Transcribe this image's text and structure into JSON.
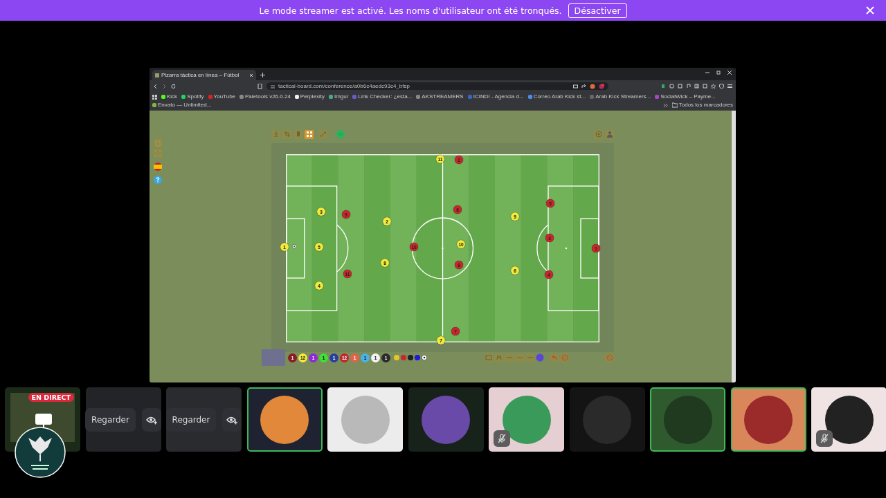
{
  "banner": {
    "message": "Le mode streamer est activé. Les noms d'utilisateur ont été tronqués.",
    "button": "Désactiver"
  },
  "browser": {
    "tab_title": "Pizarra táctica en línea – Fútbol",
    "url": "tactical-board.com/conference/a0b6c4aedc93c4_bfsp",
    "bookmarks": [
      "Kick",
      "Spotify",
      "YouTube",
      "Paletools v26.0.24",
      "Perplexity",
      "Imgur",
      "Link Checker: ¿esta...",
      "AKSTREAMERS",
      "ICINDI - Agencia d...",
      "Correo Arab Kick st...",
      "Arab Kick Streamers...",
      "SocialWick – Payme...",
      "Envato — Unlimited..."
    ],
    "all_bookmarks": "Todos los marcadores"
  },
  "board": {
    "players": [
      {
        "number": "11",
        "color": "#f2ea3c"
      },
      {
        "number": "3",
        "color": "#f2ea3c"
      },
      {
        "number": "2",
        "color": "#f2ea3c"
      },
      {
        "number": "1",
        "color": "#f2ea3c"
      },
      {
        "number": "5",
        "color": "#f2ea3c"
      },
      {
        "number": "8",
        "color": "#f2ea3c"
      },
      {
        "number": "4",
        "color": "#f2ea3c"
      },
      {
        "number": "10",
        "color": "#f2ea3c"
      },
      {
        "number": "9",
        "color": "#f2ea3c"
      },
      {
        "number": "6",
        "color": "#f2ea3c"
      },
      {
        "number": "7",
        "color": "#f2ea3c"
      },
      {
        "number": "2",
        "color": "#c8262e"
      },
      {
        "number": "9",
        "color": "#c8262e"
      },
      {
        "number": "6",
        "color": "#c8262e"
      },
      {
        "number": "10",
        "color": "#c8262e"
      },
      {
        "number": "8",
        "color": "#c8262e"
      },
      {
        "number": "11",
        "color": "#c8262e"
      },
      {
        "number": "5",
        "color": "#c8262e"
      },
      {
        "number": "3",
        "color": "#c8262e"
      },
      {
        "number": "4",
        "color": "#c8262e"
      },
      {
        "number": "1",
        "color": "#c8262e"
      },
      {
        "number": "7",
        "color": "#c8262e"
      }
    ],
    "palette": [
      {
        "number": "1",
        "color": "#8b1c24"
      },
      {
        "number": "12",
        "color": "#f2ea3c"
      },
      {
        "number": "1",
        "color": "#8a2bd6"
      },
      {
        "number": "1",
        "color": "#3fe03a"
      },
      {
        "number": "1",
        "color": "#2a3f9a"
      },
      {
        "number": "12",
        "color": "#c0262c"
      },
      {
        "number": "1",
        "color": "#e0634a"
      },
      {
        "number": "1",
        "color": "#48b3e6"
      },
      {
        "number": "1",
        "color": "#f2f2f2"
      },
      {
        "number": "1",
        "color": "#2a2a2a"
      }
    ]
  },
  "participants": [
    {
      "kind": "stream",
      "badge": "EN DIRECT"
    },
    {
      "kind": "watch",
      "button": "Regarder"
    },
    {
      "kind": "watch",
      "button": "Regarder"
    },
    {
      "kind": "avatar",
      "speaking": true,
      "muted": false
    },
    {
      "kind": "avatar",
      "speaking": false,
      "muted": false
    },
    {
      "kind": "avatar",
      "speaking": false,
      "muted": false
    },
    {
      "kind": "avatar",
      "speaking": false,
      "muted": true
    },
    {
      "kind": "avatar",
      "speaking": false,
      "muted": false
    },
    {
      "kind": "avatar",
      "speaking": true,
      "muted": false
    },
    {
      "kind": "avatar",
      "speaking": true,
      "muted": false
    },
    {
      "kind": "avatar",
      "speaking": false,
      "muted": true
    }
  ]
}
